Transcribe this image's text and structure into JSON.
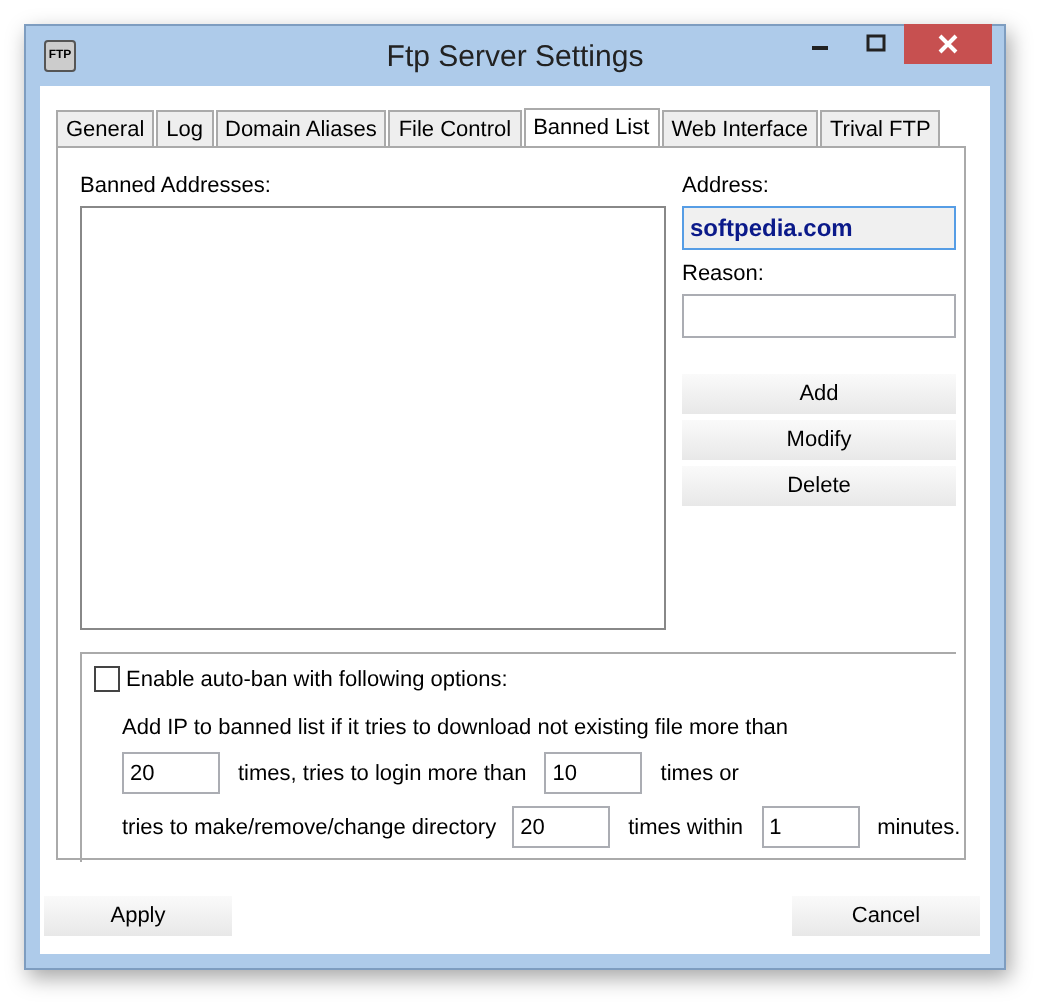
{
  "window": {
    "title": "Ftp Server Settings",
    "icon_text": "FTP"
  },
  "tabs": [
    {
      "label": "General",
      "selected": false
    },
    {
      "label": "Log",
      "selected": false
    },
    {
      "label": "Domain Aliases",
      "selected": false
    },
    {
      "label": "File Control",
      "selected": false
    },
    {
      "label": "Banned List",
      "selected": true
    },
    {
      "label": "Web Interface",
      "selected": false
    },
    {
      "label": "Trival FTP",
      "selected": false
    }
  ],
  "banned_list": {
    "label": "Banned Addresses:"
  },
  "address": {
    "label": "Address:",
    "value": "softpedia.com"
  },
  "reason": {
    "label": "Reason:"
  },
  "action_buttons": [
    "Add",
    "Modify",
    "Delete"
  ],
  "auto_ban": {
    "label": "Enable auto-ban with following options:",
    "checked": false,
    "intro": "Add IP to banned list if it tries to download not existing file more than",
    "download_count": "20",
    "login_text": "times, tries to login more than",
    "login_count": "10",
    "times_or": "times or",
    "dir_text": "tries to make/remove/change directory",
    "dir_count": "20",
    "within_text": "times within",
    "minutes": "1",
    "minutes_text": "minutes."
  },
  "buttons": [
    "Apply",
    "Cancel"
  ]
}
